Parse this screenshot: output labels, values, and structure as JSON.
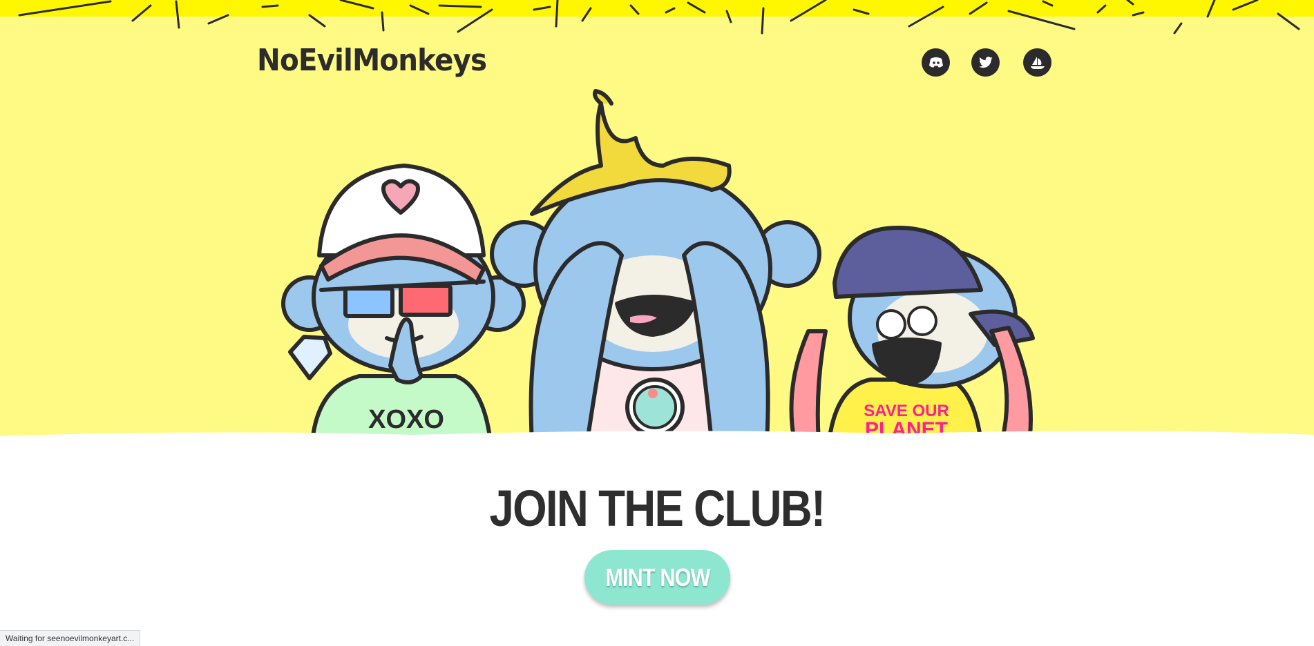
{
  "header": {
    "logo_text": "NoEvilMonkeys",
    "social": [
      {
        "name": "discord",
        "icon": "discord-icon"
      },
      {
        "name": "twitter",
        "icon": "twitter-icon"
      },
      {
        "name": "opensea",
        "icon": "opensea-icon"
      }
    ]
  },
  "hero": {
    "monkey_left_shirt": "XOXO",
    "monkey_right_shirt_line1": "SAVE OUR",
    "monkey_right_shirt_line2": "PLANET"
  },
  "cta": {
    "headline": "JOIN THE CLUB!",
    "button_label": "MINT NOW"
  },
  "browser": {
    "status_text": "Waiting for seenoevilmonkeyart.c..."
  },
  "colors": {
    "hero_bg": "#fffa84",
    "top_band": "#fff700",
    "button_bg": "#8de6cf",
    "monkey_blue": "#9cc8ee",
    "text_dark": "#2e2e2e"
  }
}
